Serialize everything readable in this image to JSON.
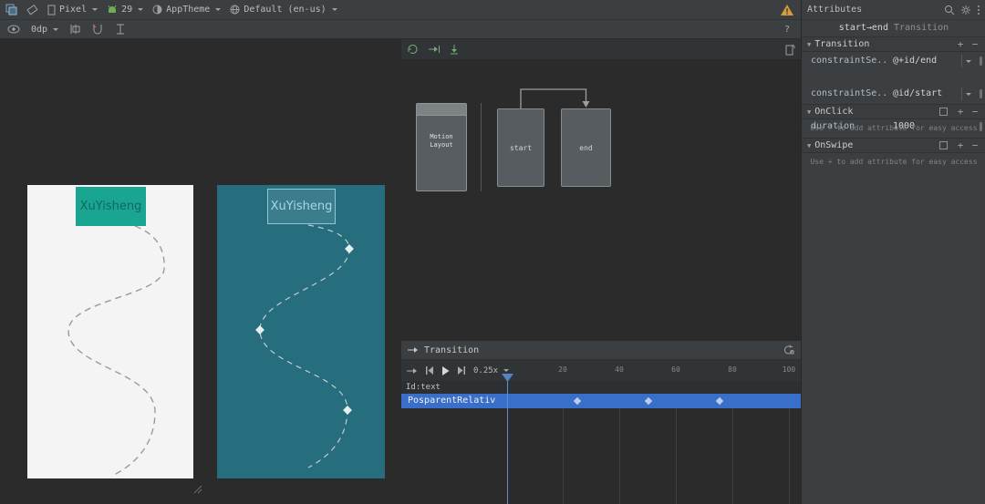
{
  "colors": {
    "timeline_selection": "#3a6fc9",
    "blueprint_teal": "#266d7d",
    "widget_teal": "#1aa492",
    "warning_orange": "#d89b3c",
    "panel_bg": "#3c3f41",
    "surface_bg": "#2b2b2b"
  },
  "icons": {
    "plus": "+",
    "minus": "−",
    "help": "?",
    "section_collapse": "▼",
    "warning_mark": "!"
  },
  "toolbar": {
    "device_label": "Pixel",
    "api_label": "29",
    "theme_label": "AppTheme",
    "locale_label": "Default (en-us)",
    "margin_label": "0dp"
  },
  "motion": {
    "motion_layout_label": "Motion Layout",
    "start_label": "start",
    "end_label": "end"
  },
  "design": {
    "widget_text_design": "XuYisheng",
    "widget_text_blueprint": "XuYisheng"
  },
  "timeline": {
    "title": "Transition",
    "speed": "0.25x",
    "ticks": [
      "20",
      "40",
      "60",
      "80",
      "100"
    ],
    "id_label": "Id:text",
    "track_label": "PosparentRelativ"
  },
  "attributes": {
    "title": "Attributes",
    "transition_name": "start→end",
    "transition_suffix": " Transition",
    "sections": {
      "transition": "Transition",
      "onclick": "OnClick",
      "onswipe": "OnSwipe"
    },
    "rows": [
      {
        "name": "constraintSe...",
        "value": "@+id/end"
      },
      {
        "name": "constraintSe...",
        "value": "@id/start"
      },
      {
        "name": "duration",
        "value": "1000"
      }
    ],
    "hint": "Use + to add attribute for easy access"
  }
}
